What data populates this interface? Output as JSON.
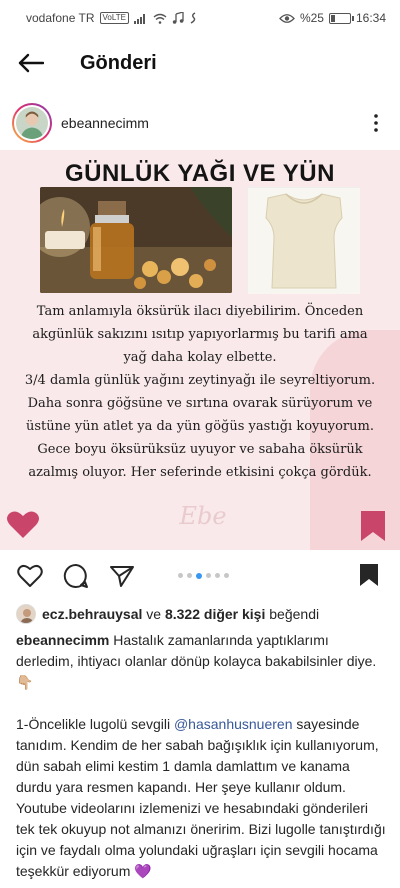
{
  "status_bar": {
    "carrier": "vodafone TR",
    "volte": "VoLTE",
    "battery_text": "%25",
    "battery_level": 0.25,
    "time": "16:34"
  },
  "header": {
    "title": "Gönderi"
  },
  "post": {
    "username": "ebeannecimm",
    "image": {
      "heading": "GÜNLÜK YAĞI VE YÜN",
      "paragraphs": [
        "Tam anlamıyla öksürük ilacı diyebilirim. Önceden akgünlük sakızını ısıtıp yapıyorlarmış  bu tarifi ama yağ daha kolay elbette.",
        "3/4 damla günlük yağını zeytinyağı ile seyreltiyorum.",
        "Daha sonra göğsüne ve sırtına ovarak sürüyorum ve üstüne yün atlet ya da yün göğüs yastığı koyuyorum. Gece boyu öksürüksüz uyuyor ve sabaha öksürük azalmış oluyor. Her seferinde etkisini çokça gördük."
      ],
      "watermark": "Ebe"
    },
    "carousel": {
      "total": 6,
      "active_index": 2
    },
    "likes": {
      "first_user": "ecz.behrauysal",
      "connector": "ve",
      "others": "8.322 diğer kişi",
      "suffix": "beğendi"
    },
    "caption": {
      "username": "ebeannecimm",
      "line1": "Hastalık zamanlarında yaptıklarımı derledim, ihtiyacı olanlar dönüp kolayca bakabilsinler diye. 👇🏼",
      "part2_prefix": "1-Öncelikle lugolü sevgili ",
      "mention": "@hasanhusnueren",
      "part2_rest": " sayesinde tanıdım. Kendim de her sabah bağışıklık için kullanıyorum, dün sabah elimi kestim 1 damla damlattım ve kanama durdu yara resmen kapandı. Her şeye kullanır oldum. Youtube videolarını izlemenizi ve hesabındaki gönderileri tek tek okuyup not almanızı öneririm. Bizi lugolle tanıştırdığı için ve faydalı olma yolundaki uğraşları için sevgili hocama teşekkür ediyorum 💜"
    }
  },
  "colors": {
    "image_bg": "#f9e9ea",
    "accent_pink": "#c9456a",
    "dot_active": "#3897f0"
  },
  "icons": [
    "back-arrow-icon",
    "more-vertical-icon",
    "heart-icon",
    "comment-icon",
    "share-icon",
    "bookmark-icon"
  ]
}
